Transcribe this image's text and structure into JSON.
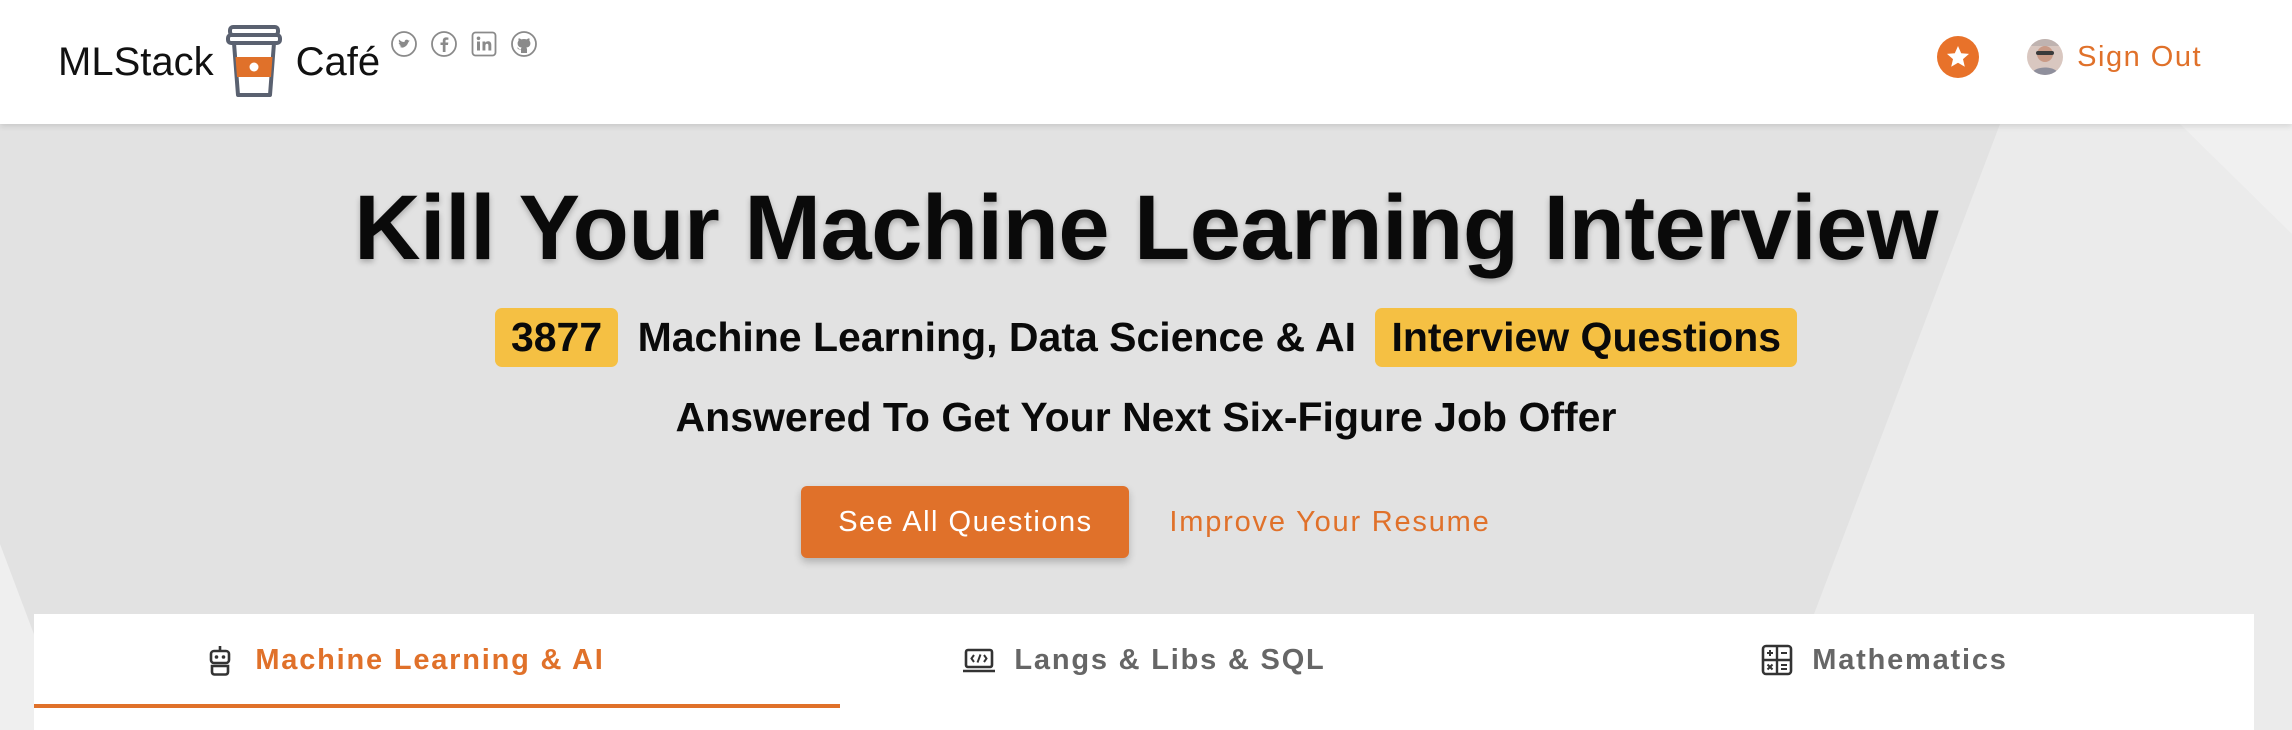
{
  "header": {
    "brand_left": "MLStack",
    "brand_right": "Café",
    "social_icons": [
      "twitter-icon",
      "facebook-icon",
      "linkedin-icon",
      "github-icon"
    ],
    "sign_out_label": "Sign Out",
    "accent_color": "#e0712a"
  },
  "hero": {
    "headline": "Kill Your Machine Learning Interview",
    "count": "3877",
    "subline_middle": "Machine Learning, Data Science & AI",
    "subline_pill": "Interview Questions",
    "tagline": "Answered To Get Your Next Six-Figure Job Offer",
    "primary_cta": "See All Questions",
    "secondary_cta": "Improve Your Resume",
    "pill_color": "#f5c043"
  },
  "tabs": [
    {
      "label": "Machine Learning & AI",
      "icon": "robot-icon",
      "active": true
    },
    {
      "label": "Langs & Libs & SQL",
      "icon": "code-icon",
      "active": false
    },
    {
      "label": "Mathematics",
      "icon": "calculator-icon",
      "active": false
    }
  ]
}
